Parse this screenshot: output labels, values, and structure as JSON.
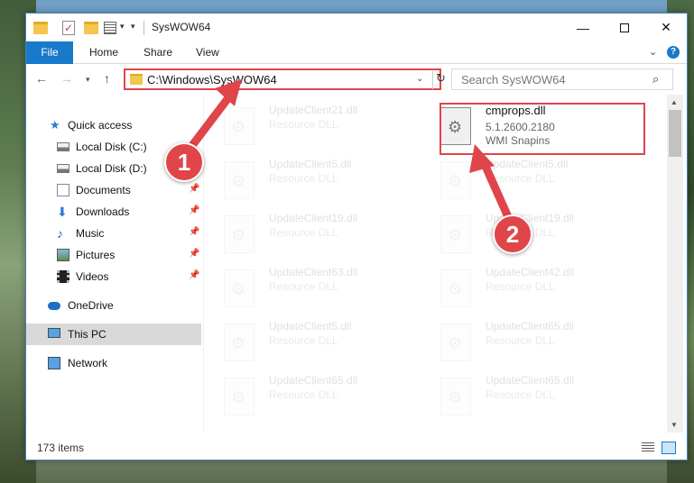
{
  "window": {
    "title": "SysWOW64"
  },
  "ribbon": {
    "tabs": [
      "File",
      "Home",
      "Share",
      "View"
    ]
  },
  "address": {
    "path": "C:\\Windows\\SysWOW64"
  },
  "search": {
    "placeholder": "Search SysWOW64"
  },
  "nav": {
    "items": [
      {
        "label": "Quick access",
        "icon": "star-icon",
        "pinned": false
      },
      {
        "label": "Local Disk (C:)",
        "icon": "disk-icon",
        "pinned": false
      },
      {
        "label": "Local Disk (D:)",
        "icon": "disk-icon",
        "pinned": false
      },
      {
        "label": "Documents",
        "icon": "documents-icon",
        "pinned": true
      },
      {
        "label": "Downloads",
        "icon": "download-icon",
        "pinned": true
      },
      {
        "label": "Music",
        "icon": "music-icon",
        "pinned": true
      },
      {
        "label": "Pictures",
        "icon": "pictures-icon",
        "pinned": true
      },
      {
        "label": "Videos",
        "icon": "videos-icon",
        "pinned": true
      },
      {
        "label": "OneDrive",
        "icon": "cloud-icon",
        "pinned": false
      },
      {
        "label": "This PC",
        "icon": "pc-icon",
        "pinned": false,
        "selected": true
      },
      {
        "label": "Network",
        "icon": "network-icon",
        "pinned": false
      }
    ]
  },
  "files": [
    {
      "name": "UpdateClient21.dll",
      "type": "Resource DLL"
    },
    {
      "name": "cmprops.dll",
      "type": "5.1.2600.2180",
      "extra": "WMI Snapins",
      "highlighted": true
    },
    {
      "name": "UpdateClient5.dll",
      "type": "Resource DLL"
    },
    {
      "name": "UpdateClient5.dll",
      "type": "Resource DLL"
    },
    {
      "name": "UpdateClient19.dll",
      "type": "Resource DLL"
    },
    {
      "name": "UpdateClient19.dll",
      "type": "Resource DLL"
    },
    {
      "name": "UpdateClient63.dll",
      "type": "Resource DLL"
    },
    {
      "name": "UpdateClient42.dll",
      "type": "Resource DLL"
    },
    {
      "name": "UpdateClient5.dll",
      "type": "Resource DLL"
    },
    {
      "name": "UpdateClient65.dll",
      "type": "Resource DLL"
    },
    {
      "name": "UpdateClient65.dll",
      "type": "Resource DLL"
    },
    {
      "name": "UpdateClient65.dll",
      "type": "Resource DLL"
    }
  ],
  "status": {
    "item_count": "173 items"
  },
  "callouts": {
    "one": "1",
    "two": "2",
    "color": "#e0454a"
  }
}
